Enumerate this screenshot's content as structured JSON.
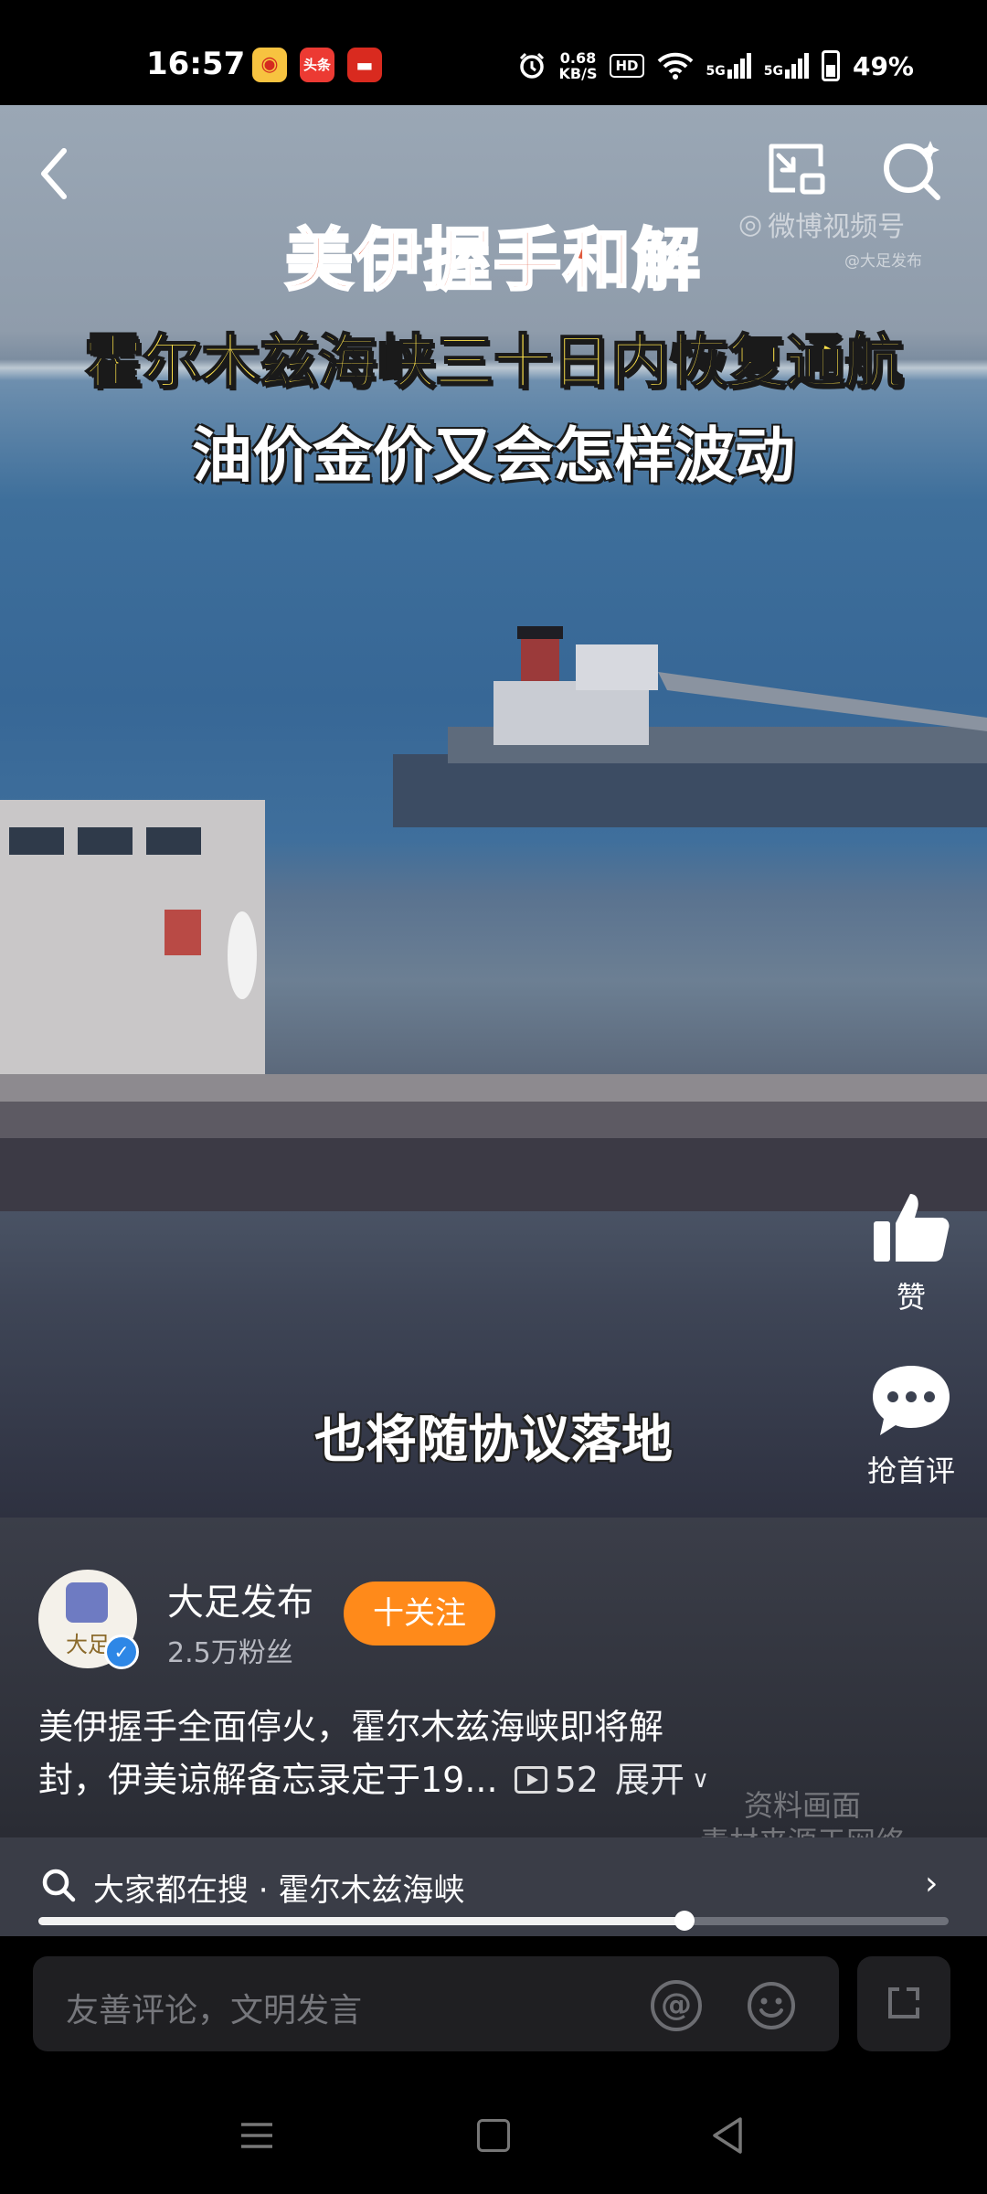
{
  "status_bar": {
    "time": "16:57",
    "apps": [
      "weibo-icon",
      "toutiao-icon",
      "news-icon"
    ],
    "toutiao_label": "头条",
    "net_speed_value": "0.68",
    "net_speed_unit": "KB/S",
    "hd_label": "HD",
    "signal1_label": "5G",
    "signal2_label": "5G",
    "battery": "49%"
  },
  "video": {
    "headline_1": "美伊握手和解",
    "headline_2": "霍尔木兹海峡三十日内恢复通航",
    "headline_3": "油价金价又会怎样波动",
    "watermark_title": "微博视频号",
    "watermark_handle": "@大足发布",
    "subtitle": "也将随协议落地"
  },
  "author": {
    "name": "大足发布",
    "fans": "2.5万粉丝",
    "follow_label": "十关注",
    "avatar_text": "大足"
  },
  "post": {
    "description_line1": "美伊握手全面停火，霍尔木兹海峡即将解",
    "description_line2": "封，伊美谅解备忘录定于19...",
    "play_count": "52",
    "expand_label": "展开",
    "watermark_line1": "资料画面",
    "watermark_line2": "素材来源于网络"
  },
  "actions": {
    "like_label": "赞",
    "comment_label": "抢首评",
    "share_label": "转发"
  },
  "search_strip": {
    "text": "大家都在搜 · 霍尔木兹海峡"
  },
  "playback": {
    "progress_fraction": 0.71
  },
  "comment_bar": {
    "placeholder": "友善评论，文明发言",
    "at_label": "@"
  },
  "colors": {
    "follow_button": "#ff8a1a",
    "verified_badge": "#2e87e6",
    "headline_yellow": "#ffe34a",
    "headline_red": "#e05a3d"
  }
}
